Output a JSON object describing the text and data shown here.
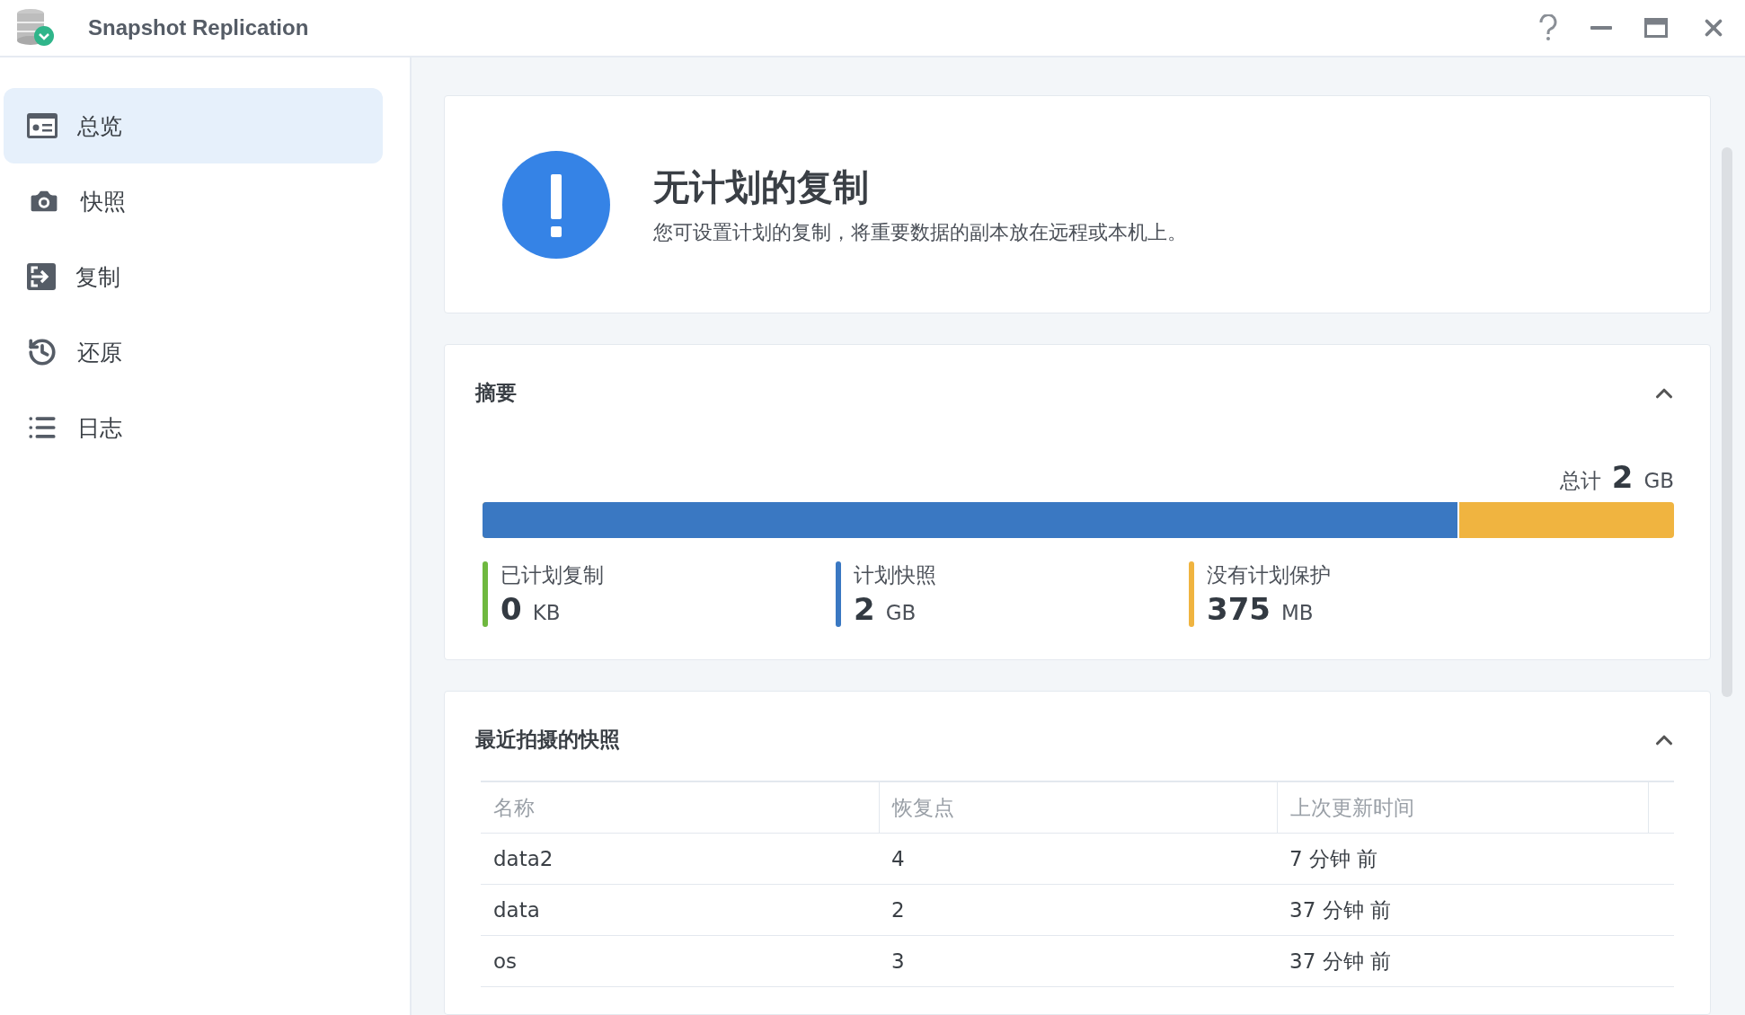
{
  "window": {
    "title": "Snapshot Replication"
  },
  "sidebar": {
    "items": [
      {
        "label": "总览",
        "selected": true
      },
      {
        "label": "快照",
        "selected": false
      },
      {
        "label": "复制",
        "selected": false
      },
      {
        "label": "还原",
        "selected": false
      },
      {
        "label": "日志",
        "selected": false
      }
    ]
  },
  "notice": {
    "title": "无计划的复制",
    "text": "您可设置计划的复制，将重要数据的副本放在远程或本机上。"
  },
  "summary": {
    "title": "摘要",
    "expanded": true,
    "total_label": "总计",
    "total_value": "2",
    "total_unit": "GB",
    "bar": {
      "level": 0.82
    },
    "legend": [
      {
        "label": "已计划复制",
        "value": "0",
        "unit": "KB",
        "color": "#6fb83f"
      },
      {
        "label": "计划快照",
        "value": "2",
        "unit": "GB",
        "color": "#3a78c2"
      },
      {
        "label": "没有计划保护",
        "value": "375",
        "unit": "MB",
        "color": "#f0b440"
      }
    ]
  },
  "recent": {
    "title": "最近拍摄的快照",
    "expanded": true,
    "columns": [
      "名称",
      "恢复点",
      "上次更新时间"
    ],
    "rows": [
      [
        "data2",
        "4",
        "7 分钟 前"
      ],
      [
        "data",
        "2",
        "37 分钟 前"
      ],
      [
        "os",
        "3",
        "37 分钟 前"
      ]
    ]
  }
}
